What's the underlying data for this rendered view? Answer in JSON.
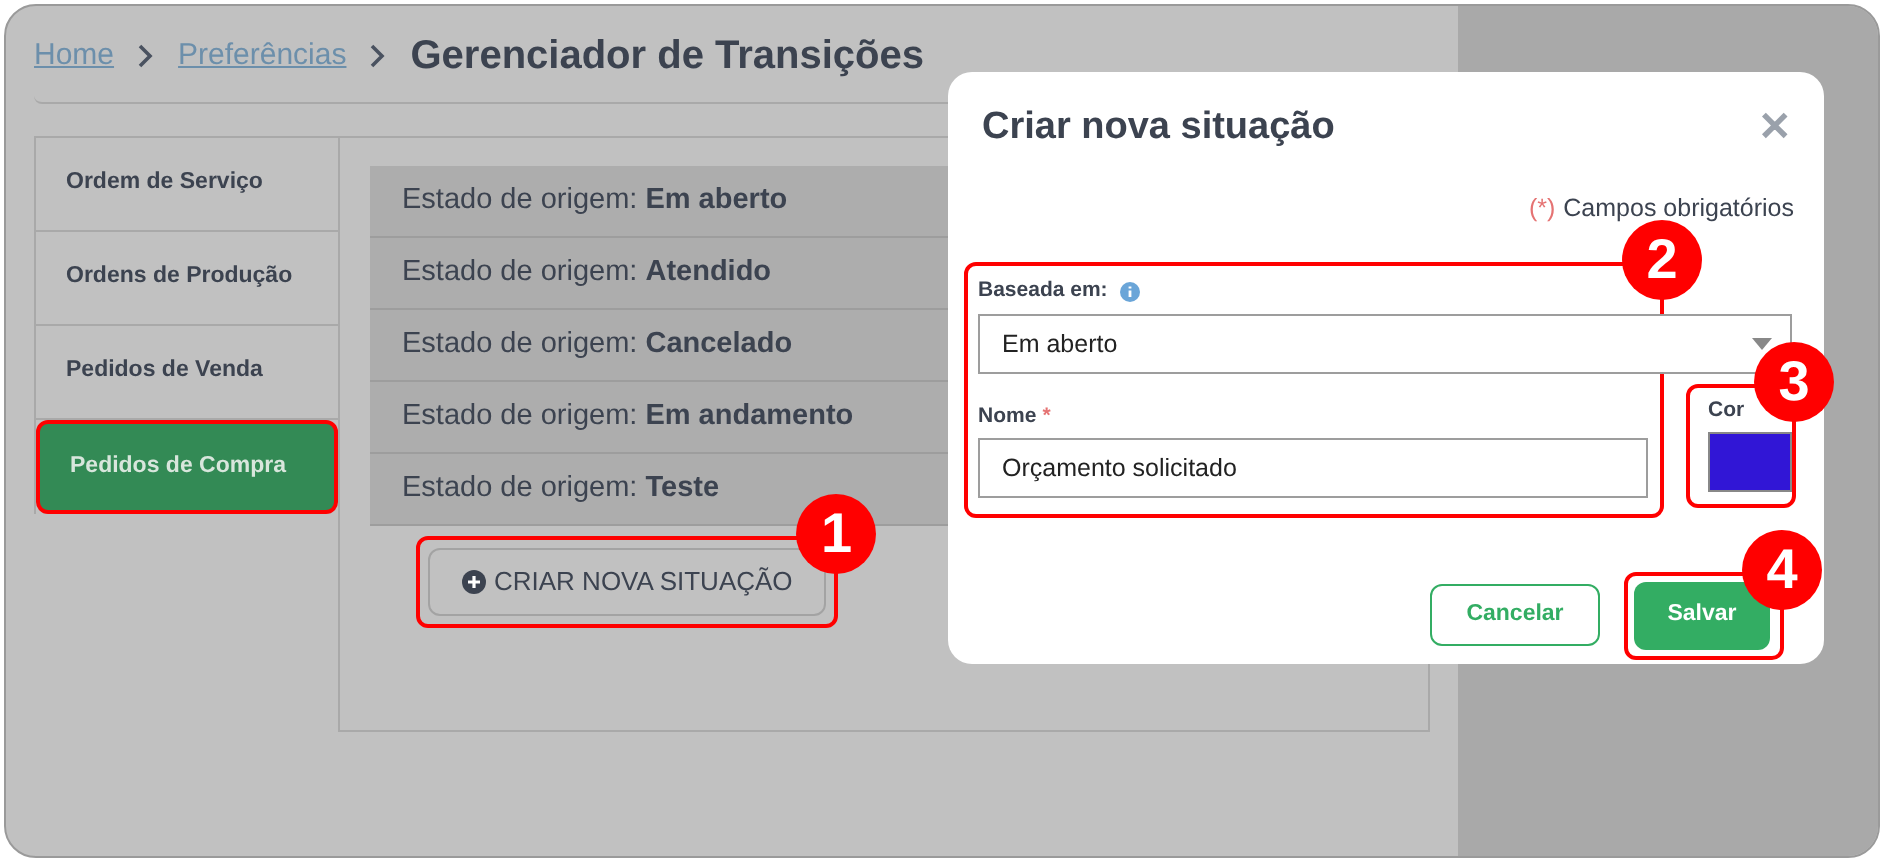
{
  "breadcrumb": {
    "links": [
      "Home",
      "Preferências"
    ],
    "title": "Gerenciador de Transições"
  },
  "sidebar": {
    "items": [
      {
        "label": "Ordem de Serviço",
        "selected": false
      },
      {
        "label": "Ordens de Produção",
        "selected": false
      },
      {
        "label": "Pedidos de Venda",
        "selected": false
      },
      {
        "label": "Pedidos de Compra",
        "selected": true
      }
    ]
  },
  "states": [
    {
      "prefix": "Estado de origem:",
      "value": "Em aberto"
    },
    {
      "prefix": "Estado de origem:",
      "value": "Atendido"
    },
    {
      "prefix": "Estado de origem:",
      "value": "Cancelado"
    },
    {
      "prefix": "Estado de origem:",
      "value": "Em andamento"
    },
    {
      "prefix": "Estado de origem:",
      "value": "Teste"
    }
  ],
  "create_button": "CRIAR NOVA SITUAÇÃO",
  "modal": {
    "title": "Criar nova situação",
    "close": "✕",
    "required_mark": "(*)",
    "required_note": "Campos obrigatórios",
    "based_on": {
      "label": "Baseada em:",
      "value": "Em aberto"
    },
    "name_field": {
      "label": "Nome",
      "required_mark": "*",
      "value": "Orçamento solicitado"
    },
    "color_field": {
      "label": "Cor",
      "color": "#3116d6"
    },
    "buttons": {
      "cancel": "Cancelar",
      "save": "Salvar"
    }
  },
  "callouts": [
    {
      "number": "1"
    },
    {
      "number": "2"
    },
    {
      "number": "3"
    },
    {
      "number": "4"
    }
  ]
}
